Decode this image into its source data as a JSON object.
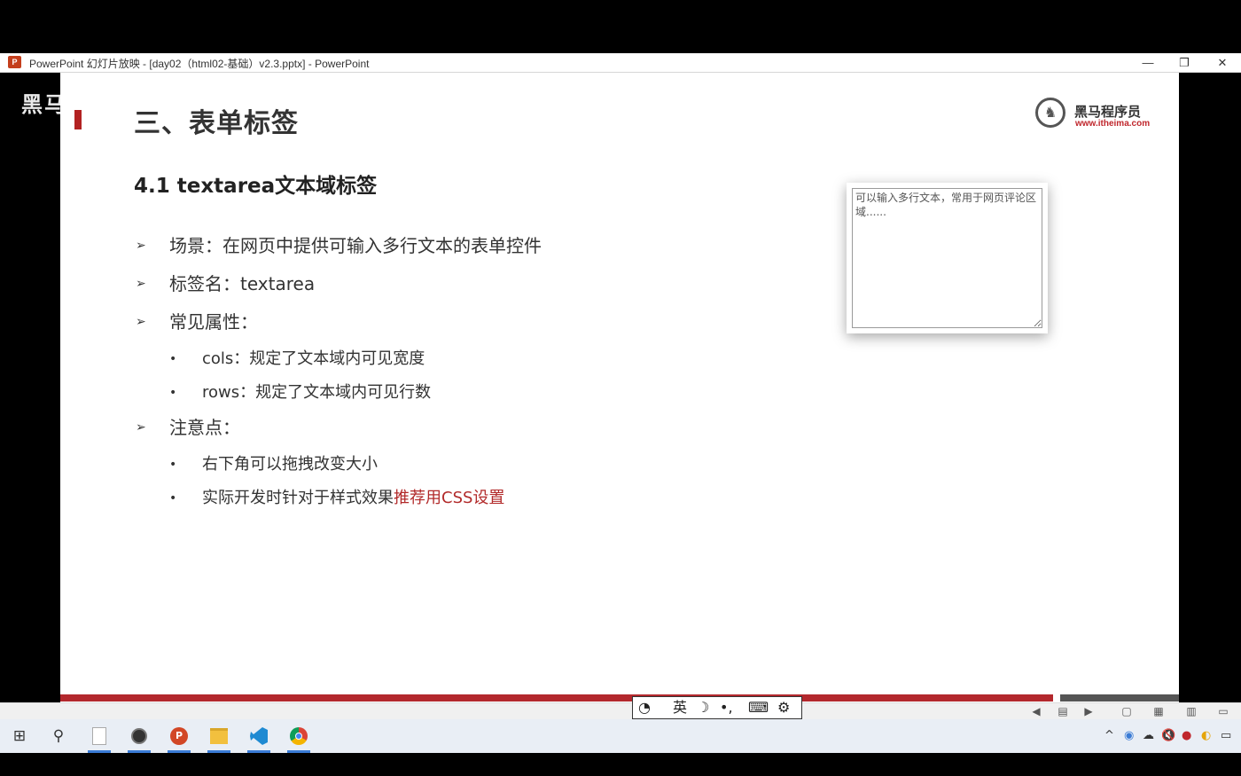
{
  "window": {
    "title": "PowerPoint 幻灯片放映 - [day02（html02-基础）v2.3.pptx] - PowerPoint",
    "app_icon": "P",
    "minimize": "—",
    "restore": "❐",
    "close": "✕"
  },
  "left_watermark": "黑马",
  "slide": {
    "heading": "三、表单标签",
    "logo": {
      "name": "黑马程序员",
      "url": "www.itheima.com"
    },
    "subheading": "4.1 textarea文本域标签",
    "bullets": [
      {
        "level": 1,
        "text": "场景：在网页中提供可输入多行文本的表单控件"
      },
      {
        "level": 1,
        "text": "标签名：textarea"
      },
      {
        "level": 1,
        "text": "常见属性："
      },
      {
        "level": 2,
        "text": "cols：规定了文本域内可见宽度"
      },
      {
        "level": 2,
        "text": "rows：规定了文本域内可见行数"
      },
      {
        "level": 1,
        "text": "注意点："
      },
      {
        "level": 2,
        "text": "右下角可以拖拽改变大小"
      },
      {
        "level": 2,
        "text_before": "实际开发时针对于样式效果",
        "text_highlight": "推荐用CSS设置"
      }
    ],
    "demo_textarea": {
      "value": "可以输入多行文本，常用于网页评论区域......"
    },
    "accent_color": "#b3282d"
  },
  "ime_toolbar": {
    "mode_label": "英",
    "moon": "☽",
    "punct": "•,",
    "keyboard": "⌨",
    "settings": "⚙"
  },
  "taskbar": {
    "start": "⊞",
    "search": "⚲",
    "apps": [
      "file-explorer-doc",
      "obs",
      "powerpoint",
      "folder",
      "vscode",
      "chrome"
    ],
    "tray": {
      "chevron": "^",
      "volume": "🔇"
    }
  }
}
